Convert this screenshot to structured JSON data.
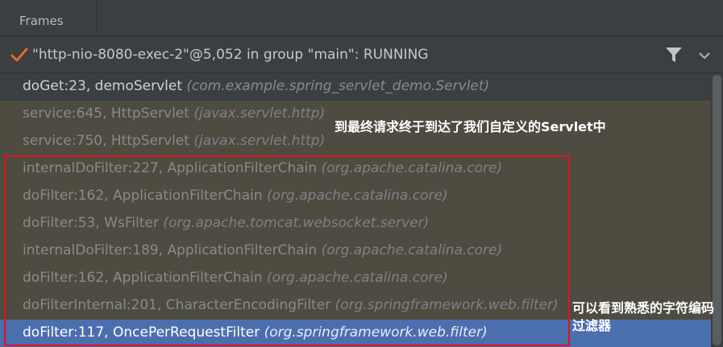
{
  "panel": {
    "title": "Frames"
  },
  "thread": {
    "label": "\"http-nio-8080-exec-2\"@5,052 in group \"main\": RUNNING",
    "status_color": "#e06c2a"
  },
  "frames": [
    {
      "location": "doGet:23, demoServlet",
      "package": "(com.example.spring_servlet_demo.Servlet)"
    },
    {
      "location": "service:645, HttpServlet",
      "package": "(javax.servlet.http)"
    },
    {
      "location": "service:750, HttpServlet",
      "package": "(javax.servlet.http)"
    },
    {
      "location": "internalDoFilter:227, ApplicationFilterChain",
      "package": "(org.apache.catalina.core)"
    },
    {
      "location": "doFilter:162, ApplicationFilterChain",
      "package": "(org.apache.catalina.core)"
    },
    {
      "location": "doFilter:53, WsFilter",
      "package": "(org.apache.tomcat.websocket.server)"
    },
    {
      "location": "internalDoFilter:189, ApplicationFilterChain",
      "package": "(org.apache.catalina.core)"
    },
    {
      "location": "doFilter:162, ApplicationFilterChain",
      "package": "(org.apache.catalina.core)"
    },
    {
      "location": "doFilterInternal:201, CharacterEncodingFilter",
      "package": "(org.springframework.web.filter)"
    },
    {
      "location": "doFilter:117, OncePerRequestFilter",
      "package": "(org.springframework.web.filter)"
    }
  ],
  "annotations": {
    "note_servlet": "到最终请求终于到达了我们自定义的Servlet中",
    "note_filter": "可以看到熟悉的字符编码过滤器"
  },
  "colors": {
    "highlight_border": "#e0141c",
    "selected_row": "#4b6eaf"
  }
}
